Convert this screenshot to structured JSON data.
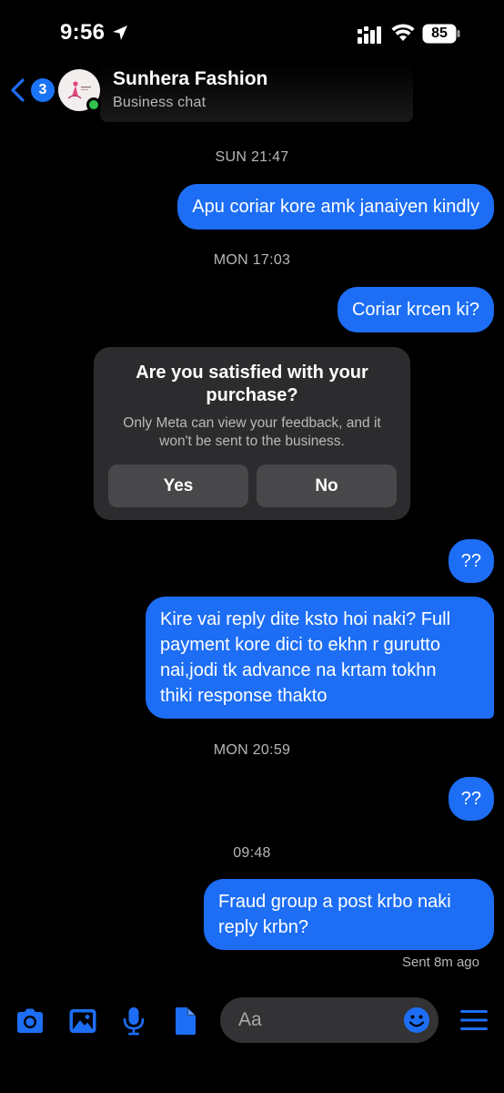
{
  "status_bar": {
    "time": "9:56",
    "battery": "85"
  },
  "header": {
    "back_badge": "3",
    "name": "Sunhera Fashion",
    "subtitle": "Business chat"
  },
  "messages": [
    {
      "type": "timestamp",
      "text": "SUN 21:47"
    },
    {
      "type": "outgoing",
      "text": "Apu coriar kore amk janaiyen kindly"
    },
    {
      "type": "timestamp",
      "text": "MON 17:03"
    },
    {
      "type": "outgoing",
      "text": "Coriar krcen ki?"
    },
    {
      "type": "outgoing",
      "text": "??"
    },
    {
      "type": "outgoing",
      "text": "Kire vai reply dite ksto hoi naki? Full\npayment kore dici to ekhn r gurutto\nnai,jodi tk advance na krtam tokhn\nthiki response thakto"
    },
    {
      "type": "timestamp",
      "text": "MON 20:59"
    },
    {
      "type": "outgoing",
      "text": "??"
    },
    {
      "type": "timestamp",
      "text": "09:48"
    },
    {
      "type": "outgoing",
      "text": "Fraud group a post krbo naki\nreply krbn?"
    }
  ],
  "feedback": {
    "title": "Are you satisfied with your purchase?",
    "description": "Only Meta can view your feedback, and it won't be sent to the business.",
    "yes_label": "Yes",
    "no_label": "No"
  },
  "sent_status": "Sent 8m ago",
  "composer": {
    "placeholder": "Aa",
    "icons": [
      "camera-icon",
      "gallery-icon",
      "microphone-icon",
      "file-icon",
      "emoji-icon",
      "menu-icon"
    ]
  },
  "colors": {
    "accent": "#1d6ef5",
    "background": "#000000",
    "card": "#2c2c2e",
    "online": "#31c24d"
  }
}
